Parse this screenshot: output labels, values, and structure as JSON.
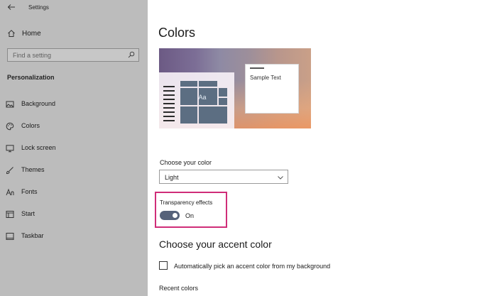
{
  "window": {
    "title": "Settings"
  },
  "sidebar": {
    "home_label": "Home",
    "search_placeholder": "Find a setting",
    "section_header": "Personalization",
    "items": [
      {
        "label": "Background",
        "icon": "picture-icon"
      },
      {
        "label": "Colors",
        "icon": "palette-icon"
      },
      {
        "label": "Lock screen",
        "icon": "monitor-icon"
      },
      {
        "label": "Themes",
        "icon": "brush-icon"
      },
      {
        "label": "Fonts",
        "icon": "font-icon"
      },
      {
        "label": "Start",
        "icon": "start-icon"
      },
      {
        "label": "Taskbar",
        "icon": "taskbar-icon"
      }
    ]
  },
  "main": {
    "title": "Colors",
    "preview": {
      "sample_text": "Sample Text",
      "tile_label": "Aa"
    },
    "choose_color": {
      "label": "Choose your color",
      "value": "Light"
    },
    "transparency": {
      "label": "Transparency effects",
      "state": "On",
      "enabled": true
    },
    "accent": {
      "title": "Choose your accent color",
      "auto_pick_label": "Automatically pick an accent color from my background",
      "auto_pick_checked": false,
      "recent_label": "Recent colors"
    }
  },
  "colors": {
    "sidebar_bg": "#bcbcbc",
    "toggle_on": "#56627a",
    "highlight_border": "#cf2d78"
  }
}
